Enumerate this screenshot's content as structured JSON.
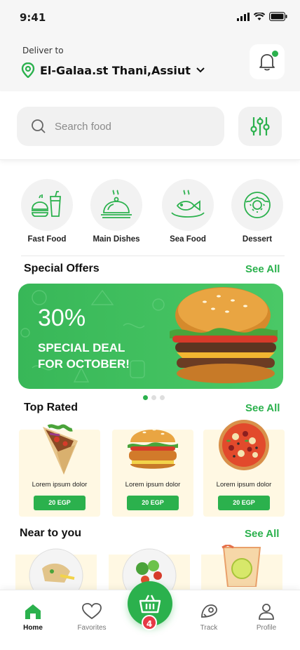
{
  "status_bar": {
    "time": "9:41"
  },
  "header": {
    "deliver_label": "Deliver to",
    "location": "El-Galaa.st Thani,Assiut"
  },
  "search": {
    "placeholder": "Search food"
  },
  "categories": [
    {
      "label": "Fast Food",
      "icon": "fast-food-icon"
    },
    {
      "label": "Main Dishes",
      "icon": "cloche-icon"
    },
    {
      "label": "Sea Food",
      "icon": "fish-plate-icon"
    },
    {
      "label": "Dessert",
      "icon": "donut-icon"
    }
  ],
  "special_offers": {
    "title": "Special Offers",
    "see_all": "See All",
    "banner": {
      "percent": "30%",
      "line1": "SPECIAL DEAL",
      "line2": "FOR OCTOBER!"
    },
    "carousel_active_index": 0,
    "carousel_count": 3
  },
  "top_rated": {
    "title": "Top Rated",
    "see_all": "See All",
    "items": [
      {
        "name": "Lorem ipsum dolor",
        "price": "20 EGP",
        "image": "shawarma-wrap"
      },
      {
        "name": "Lorem ipsum dolor",
        "price": "20 EGP",
        "image": "chicken-burger"
      },
      {
        "name": "Lorem ipsum dolor",
        "price": "20 EGP",
        "image": "pizza"
      }
    ]
  },
  "near_to_you": {
    "title": "Near to you",
    "see_all": "See All",
    "items": [
      {
        "image": "chicken-pasta-plate"
      },
      {
        "image": "salad-plate"
      },
      {
        "image": "lemon-drink"
      }
    ]
  },
  "bottom_nav": {
    "items": [
      {
        "label": "Home",
        "icon": "home-icon",
        "active": true
      },
      {
        "label": "Favorites",
        "icon": "heart-icon",
        "active": false
      },
      {
        "label": "Track",
        "icon": "map-pin-icon",
        "active": false
      },
      {
        "label": "Profile",
        "icon": "user-icon",
        "active": false
      }
    ],
    "cart_count": "4"
  },
  "colors": {
    "accent": "#2bb14d",
    "badge": "#e63946",
    "card_bg": "#fff8e3"
  }
}
